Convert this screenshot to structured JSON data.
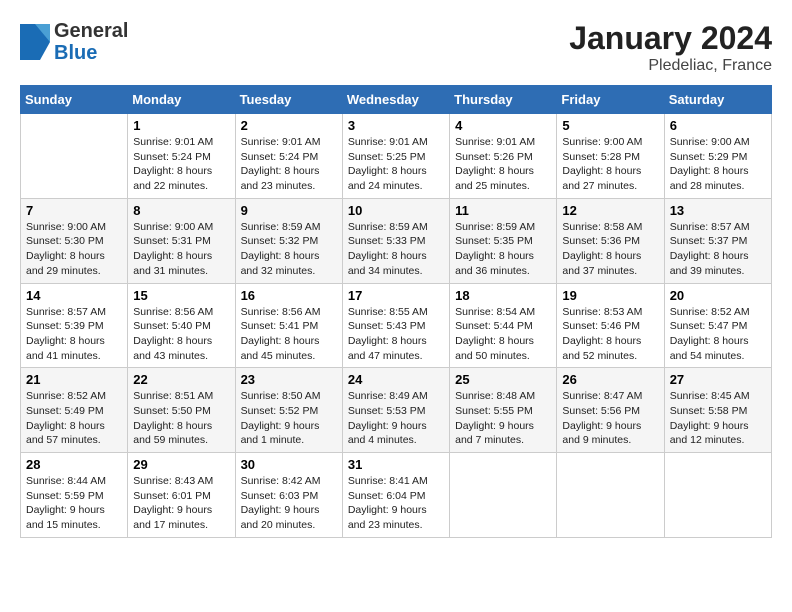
{
  "logo": {
    "general": "General",
    "blue": "Blue"
  },
  "title": "January 2024",
  "subtitle": "Pledeliac, France",
  "days_of_week": [
    "Sunday",
    "Monday",
    "Tuesday",
    "Wednesday",
    "Thursday",
    "Friday",
    "Saturday"
  ],
  "weeks": [
    [
      {
        "day": null,
        "sunrise": null,
        "sunset": null,
        "daylight": null
      },
      {
        "day": "1",
        "sunrise": "Sunrise: 9:01 AM",
        "sunset": "Sunset: 5:24 PM",
        "daylight": "Daylight: 8 hours and 22 minutes."
      },
      {
        "day": "2",
        "sunrise": "Sunrise: 9:01 AM",
        "sunset": "Sunset: 5:24 PM",
        "daylight": "Daylight: 8 hours and 23 minutes."
      },
      {
        "day": "3",
        "sunrise": "Sunrise: 9:01 AM",
        "sunset": "Sunset: 5:25 PM",
        "daylight": "Daylight: 8 hours and 24 minutes."
      },
      {
        "day": "4",
        "sunrise": "Sunrise: 9:01 AM",
        "sunset": "Sunset: 5:26 PM",
        "daylight": "Daylight: 8 hours and 25 minutes."
      },
      {
        "day": "5",
        "sunrise": "Sunrise: 9:00 AM",
        "sunset": "Sunset: 5:28 PM",
        "daylight": "Daylight: 8 hours and 27 minutes."
      },
      {
        "day": "6",
        "sunrise": "Sunrise: 9:00 AM",
        "sunset": "Sunset: 5:29 PM",
        "daylight": "Daylight: 8 hours and 28 minutes."
      }
    ],
    [
      {
        "day": "7",
        "sunrise": "Sunrise: 9:00 AM",
        "sunset": "Sunset: 5:30 PM",
        "daylight": "Daylight: 8 hours and 29 minutes."
      },
      {
        "day": "8",
        "sunrise": "Sunrise: 9:00 AM",
        "sunset": "Sunset: 5:31 PM",
        "daylight": "Daylight: 8 hours and 31 minutes."
      },
      {
        "day": "9",
        "sunrise": "Sunrise: 8:59 AM",
        "sunset": "Sunset: 5:32 PM",
        "daylight": "Daylight: 8 hours and 32 minutes."
      },
      {
        "day": "10",
        "sunrise": "Sunrise: 8:59 AM",
        "sunset": "Sunset: 5:33 PM",
        "daylight": "Daylight: 8 hours and 34 minutes."
      },
      {
        "day": "11",
        "sunrise": "Sunrise: 8:59 AM",
        "sunset": "Sunset: 5:35 PM",
        "daylight": "Daylight: 8 hours and 36 minutes."
      },
      {
        "day": "12",
        "sunrise": "Sunrise: 8:58 AM",
        "sunset": "Sunset: 5:36 PM",
        "daylight": "Daylight: 8 hours and 37 minutes."
      },
      {
        "day": "13",
        "sunrise": "Sunrise: 8:57 AM",
        "sunset": "Sunset: 5:37 PM",
        "daylight": "Daylight: 8 hours and 39 minutes."
      }
    ],
    [
      {
        "day": "14",
        "sunrise": "Sunrise: 8:57 AM",
        "sunset": "Sunset: 5:39 PM",
        "daylight": "Daylight: 8 hours and 41 minutes."
      },
      {
        "day": "15",
        "sunrise": "Sunrise: 8:56 AM",
        "sunset": "Sunset: 5:40 PM",
        "daylight": "Daylight: 8 hours and 43 minutes."
      },
      {
        "day": "16",
        "sunrise": "Sunrise: 8:56 AM",
        "sunset": "Sunset: 5:41 PM",
        "daylight": "Daylight: 8 hours and 45 minutes."
      },
      {
        "day": "17",
        "sunrise": "Sunrise: 8:55 AM",
        "sunset": "Sunset: 5:43 PM",
        "daylight": "Daylight: 8 hours and 47 minutes."
      },
      {
        "day": "18",
        "sunrise": "Sunrise: 8:54 AM",
        "sunset": "Sunset: 5:44 PM",
        "daylight": "Daylight: 8 hours and 50 minutes."
      },
      {
        "day": "19",
        "sunrise": "Sunrise: 8:53 AM",
        "sunset": "Sunset: 5:46 PM",
        "daylight": "Daylight: 8 hours and 52 minutes."
      },
      {
        "day": "20",
        "sunrise": "Sunrise: 8:52 AM",
        "sunset": "Sunset: 5:47 PM",
        "daylight": "Daylight: 8 hours and 54 minutes."
      }
    ],
    [
      {
        "day": "21",
        "sunrise": "Sunrise: 8:52 AM",
        "sunset": "Sunset: 5:49 PM",
        "daylight": "Daylight: 8 hours and 57 minutes."
      },
      {
        "day": "22",
        "sunrise": "Sunrise: 8:51 AM",
        "sunset": "Sunset: 5:50 PM",
        "daylight": "Daylight: 8 hours and 59 minutes."
      },
      {
        "day": "23",
        "sunrise": "Sunrise: 8:50 AM",
        "sunset": "Sunset: 5:52 PM",
        "daylight": "Daylight: 9 hours and 1 minute."
      },
      {
        "day": "24",
        "sunrise": "Sunrise: 8:49 AM",
        "sunset": "Sunset: 5:53 PM",
        "daylight": "Daylight: 9 hours and 4 minutes."
      },
      {
        "day": "25",
        "sunrise": "Sunrise: 8:48 AM",
        "sunset": "Sunset: 5:55 PM",
        "daylight": "Daylight: 9 hours and 7 minutes."
      },
      {
        "day": "26",
        "sunrise": "Sunrise: 8:47 AM",
        "sunset": "Sunset: 5:56 PM",
        "daylight": "Daylight: 9 hours and 9 minutes."
      },
      {
        "day": "27",
        "sunrise": "Sunrise: 8:45 AM",
        "sunset": "Sunset: 5:58 PM",
        "daylight": "Daylight: 9 hours and 12 minutes."
      }
    ],
    [
      {
        "day": "28",
        "sunrise": "Sunrise: 8:44 AM",
        "sunset": "Sunset: 5:59 PM",
        "daylight": "Daylight: 9 hours and 15 minutes."
      },
      {
        "day": "29",
        "sunrise": "Sunrise: 8:43 AM",
        "sunset": "Sunset: 6:01 PM",
        "daylight": "Daylight: 9 hours and 17 minutes."
      },
      {
        "day": "30",
        "sunrise": "Sunrise: 8:42 AM",
        "sunset": "Sunset: 6:03 PM",
        "daylight": "Daylight: 9 hours and 20 minutes."
      },
      {
        "day": "31",
        "sunrise": "Sunrise: 8:41 AM",
        "sunset": "Sunset: 6:04 PM",
        "daylight": "Daylight: 9 hours and 23 minutes."
      },
      {
        "day": null,
        "sunrise": null,
        "sunset": null,
        "daylight": null
      },
      {
        "day": null,
        "sunrise": null,
        "sunset": null,
        "daylight": null
      },
      {
        "day": null,
        "sunrise": null,
        "sunset": null,
        "daylight": null
      }
    ]
  ]
}
